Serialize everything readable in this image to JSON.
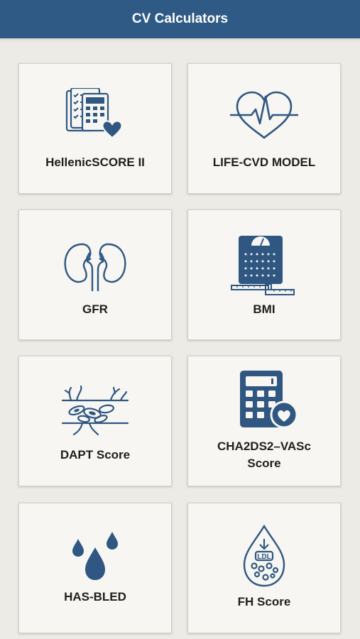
{
  "header": {
    "title": "CV Calculators"
  },
  "colors": {
    "header_bg": "#2e5a85",
    "icon": "#2f5782",
    "card_bg": "#f7f6f2",
    "page_bg": "#ecebe6"
  },
  "cards": [
    {
      "label": "HellenicSCORE II",
      "icon": "checklist-calculator-heart-icon"
    },
    {
      "label": "LIFE-CVD MODEL",
      "icon": "heart-pulse-icon"
    },
    {
      "label": "GFR",
      "icon": "kidneys-icon"
    },
    {
      "label": "BMI",
      "icon": "scale-icon"
    },
    {
      "label": "DAPT Score",
      "icon": "blood-vessel-icon"
    },
    {
      "label_line1": "CHA2DS2–VASc",
      "label_line2": "Score",
      "icon": "calculator-heart-icon"
    },
    {
      "label": "HAS-BLED",
      "icon": "blood-drops-icon"
    },
    {
      "label": "FH Score",
      "icon": "ldl-drop-icon"
    }
  ]
}
